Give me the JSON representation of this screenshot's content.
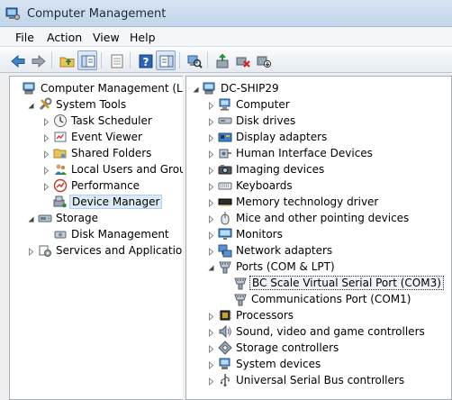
{
  "window": {
    "title": "Computer Management"
  },
  "menu": [
    "File",
    "Action",
    "View",
    "Help"
  ],
  "left_tree": [
    {
      "label": "Computer Management (Local",
      "level": 0,
      "exp": "none",
      "icon": "computer-management-icon"
    },
    {
      "label": "System Tools",
      "level": 1,
      "exp": "open",
      "icon": "system-tools-icon"
    },
    {
      "label": "Task Scheduler",
      "level": 2,
      "exp": "closed",
      "icon": "task-scheduler-icon"
    },
    {
      "label": "Event Viewer",
      "level": 2,
      "exp": "closed",
      "icon": "event-viewer-icon"
    },
    {
      "label": "Shared Folders",
      "level": 2,
      "exp": "closed",
      "icon": "shared-folders-icon"
    },
    {
      "label": "Local Users and Groups",
      "level": 2,
      "exp": "closed",
      "icon": "users-groups-icon"
    },
    {
      "label": "Performance",
      "level": 2,
      "exp": "closed",
      "icon": "performance-icon"
    },
    {
      "label": "Device Manager",
      "level": 2,
      "exp": "none",
      "icon": "device-manager-icon",
      "selected": true
    },
    {
      "label": "Storage",
      "level": 1,
      "exp": "open",
      "icon": "storage-icon"
    },
    {
      "label": "Disk Management",
      "level": 2,
      "exp": "none",
      "icon": "disk-management-icon"
    },
    {
      "label": "Services and Applications",
      "level": 1,
      "exp": "closed",
      "icon": "services-icon"
    }
  ],
  "right_tree": [
    {
      "label": "DC-SHIP29",
      "level": 0,
      "exp": "open",
      "icon": "computer-root-icon"
    },
    {
      "label": "Computer",
      "level": 1,
      "exp": "closed",
      "icon": "computer-icon"
    },
    {
      "label": "Disk drives",
      "level": 1,
      "exp": "closed",
      "icon": "disk-drive-icon"
    },
    {
      "label": "Display adapters",
      "level": 1,
      "exp": "closed",
      "icon": "display-adapter-icon"
    },
    {
      "label": "Human Interface Devices",
      "level": 1,
      "exp": "closed",
      "icon": "hid-icon"
    },
    {
      "label": "Imaging devices",
      "level": 1,
      "exp": "closed",
      "icon": "imaging-icon"
    },
    {
      "label": "Keyboards",
      "level": 1,
      "exp": "closed",
      "icon": "keyboard-icon"
    },
    {
      "label": "Memory technology driver",
      "level": 1,
      "exp": "closed",
      "icon": "memory-icon"
    },
    {
      "label": "Mice and other pointing devices",
      "level": 1,
      "exp": "closed",
      "icon": "mouse-icon"
    },
    {
      "label": "Monitors",
      "level": 1,
      "exp": "closed",
      "icon": "monitor-icon"
    },
    {
      "label": "Network adapters",
      "level": 1,
      "exp": "closed",
      "icon": "network-icon"
    },
    {
      "label": "Ports (COM & LPT)",
      "level": 1,
      "exp": "open",
      "icon": "port-icon"
    },
    {
      "label": "BC Scale Virtual Serial Port (COM3)",
      "level": 2,
      "exp": "none",
      "icon": "port-icon",
      "selected": true
    },
    {
      "label": "Communications Port (COM1)",
      "level": 2,
      "exp": "none",
      "icon": "port-icon"
    },
    {
      "label": "Processors",
      "level": 1,
      "exp": "closed",
      "icon": "processor-icon"
    },
    {
      "label": "Sound, video and game controllers",
      "level": 1,
      "exp": "closed",
      "icon": "sound-icon"
    },
    {
      "label": "Storage controllers",
      "level": 1,
      "exp": "closed",
      "icon": "storage-controller-icon"
    },
    {
      "label": "System devices",
      "level": 1,
      "exp": "closed",
      "icon": "system-devices-icon"
    },
    {
      "label": "Universal Serial Bus controllers",
      "level": 1,
      "exp": "closed",
      "icon": "usb-icon"
    }
  ]
}
